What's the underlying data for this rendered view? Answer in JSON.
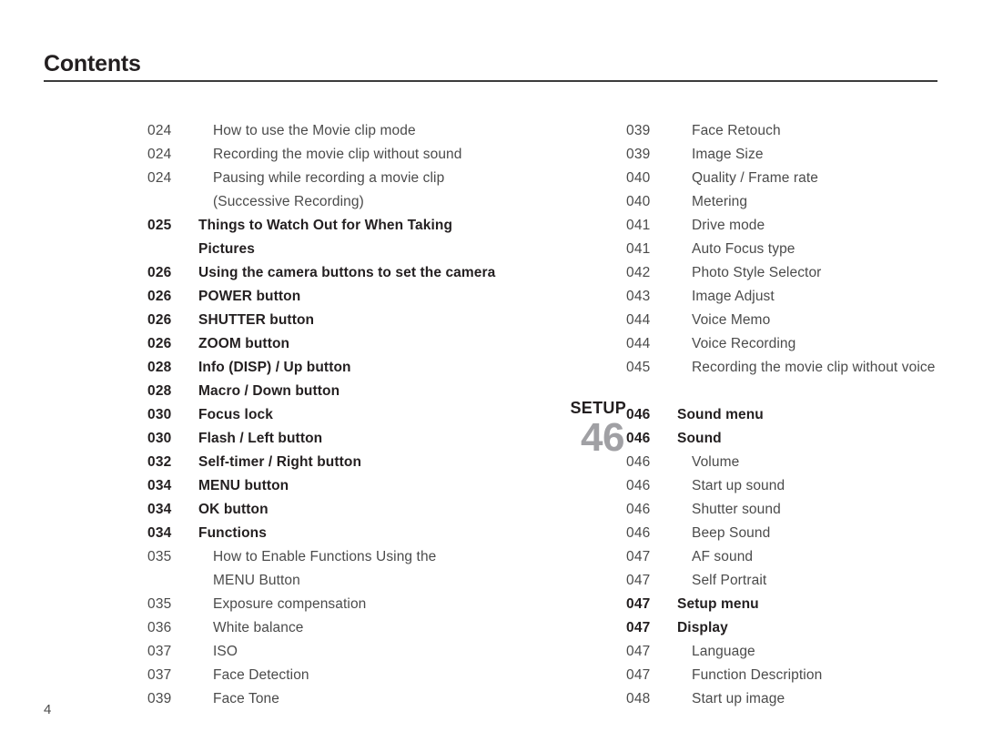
{
  "header": {
    "title": "Contents"
  },
  "footer": {
    "page_number": "4"
  },
  "chapter_marker": {
    "label": "SETUP",
    "number": "46"
  },
  "colors": {
    "text": "#4b4b4b",
    "heading": "#231f20",
    "rule": "#3c3c3c",
    "marker_number": "#a0a0a4"
  },
  "toc": {
    "left_column": [
      {
        "page": "024",
        "label": "How to use the Movie clip mode",
        "bold": false,
        "sub": true
      },
      {
        "page": "024",
        "label": "Recording the movie clip without sound",
        "bold": false,
        "sub": true
      },
      {
        "page": "024",
        "label": "Pausing while recording a movie clip",
        "bold": false,
        "sub": true
      },
      {
        "page": "",
        "label": "(Successive Recording)",
        "bold": false,
        "sub": true
      },
      {
        "page": "025",
        "label": "Things to Watch Out for When Taking",
        "bold": true,
        "sub": false
      },
      {
        "page": "",
        "label": "Pictures",
        "bold": true,
        "sub": false
      },
      {
        "page": "026",
        "label": "Using the camera buttons to set the camera",
        "bold": true,
        "sub": false
      },
      {
        "page": "026",
        "label": "POWER button",
        "bold": true,
        "sub": false
      },
      {
        "page": "026",
        "label": "SHUTTER button",
        "bold": true,
        "sub": false
      },
      {
        "page": "026",
        "label": "ZOOM button",
        "bold": true,
        "sub": false
      },
      {
        "page": "028",
        "label": "Info (DISP) / Up button",
        "bold": true,
        "sub": false
      },
      {
        "page": "028",
        "label": "Macro / Down button",
        "bold": true,
        "sub": false
      },
      {
        "page": "030",
        "label": "Focus lock",
        "bold": true,
        "sub": false
      },
      {
        "page": "030",
        "label": "Flash / Left button",
        "bold": true,
        "sub": false
      },
      {
        "page": "032",
        "label": "Self-timer / Right button",
        "bold": true,
        "sub": false
      },
      {
        "page": "034",
        "label": "MENU button",
        "bold": true,
        "sub": false
      },
      {
        "page": "034",
        "label": "OK button",
        "bold": true,
        "sub": false
      },
      {
        "page": "034",
        "label": "Functions",
        "bold": true,
        "sub": false
      },
      {
        "page": "035",
        "label": "How to Enable Functions Using the",
        "bold": false,
        "sub": true
      },
      {
        "page": "",
        "label": "MENU Button",
        "bold": false,
        "sub": true
      },
      {
        "page": "035",
        "label": "Exposure compensation",
        "bold": false,
        "sub": true
      },
      {
        "page": "036",
        "label": "White balance",
        "bold": false,
        "sub": true
      },
      {
        "page": "037",
        "label": "ISO",
        "bold": false,
        "sub": true
      },
      {
        "page": "037",
        "label": "Face Detection",
        "bold": false,
        "sub": true
      },
      {
        "page": "039",
        "label": "Face Tone",
        "bold": false,
        "sub": true
      }
    ],
    "right_column": [
      {
        "page": "039",
        "label": "Face Retouch",
        "bold": false,
        "sub": true
      },
      {
        "page": "039",
        "label": "Image Size",
        "bold": false,
        "sub": true
      },
      {
        "page": "040",
        "label": "Quality / Frame rate",
        "bold": false,
        "sub": true
      },
      {
        "page": "040",
        "label": "Metering",
        "bold": false,
        "sub": true
      },
      {
        "page": "041",
        "label": "Drive mode",
        "bold": false,
        "sub": true
      },
      {
        "page": "041",
        "label": "Auto Focus type",
        "bold": false,
        "sub": true
      },
      {
        "page": "042",
        "label": "Photo Style Selector",
        "bold": false,
        "sub": true
      },
      {
        "page": "043",
        "label": "Image Adjust",
        "bold": false,
        "sub": true
      },
      {
        "page": "044",
        "label": "Voice Memo",
        "bold": false,
        "sub": true
      },
      {
        "page": "044",
        "label": "Voice Recording",
        "bold": false,
        "sub": true
      },
      {
        "page": "045",
        "label": "Recording the movie clip without voice",
        "bold": false,
        "sub": true
      },
      {
        "page": "",
        "label": "",
        "bold": false,
        "sub": false,
        "spacer": true
      },
      {
        "page": "046",
        "label": "Sound menu",
        "bold": true,
        "sub": false
      },
      {
        "page": "046",
        "label": "Sound",
        "bold": true,
        "sub": false
      },
      {
        "page": "046",
        "label": "Volume",
        "bold": false,
        "sub": true
      },
      {
        "page": "046",
        "label": "Start up sound",
        "bold": false,
        "sub": true
      },
      {
        "page": "046",
        "label": "Shutter sound",
        "bold": false,
        "sub": true
      },
      {
        "page": "046",
        "label": "Beep Sound",
        "bold": false,
        "sub": true
      },
      {
        "page": "047",
        "label": "AF sound",
        "bold": false,
        "sub": true
      },
      {
        "page": "047",
        "label": "Self Portrait",
        "bold": false,
        "sub": true
      },
      {
        "page": "047",
        "label": "Setup menu",
        "bold": true,
        "sub": false
      },
      {
        "page": "047",
        "label": "Display",
        "bold": true,
        "sub": false
      },
      {
        "page": "047",
        "label": "Language",
        "bold": false,
        "sub": true
      },
      {
        "page": "047",
        "label": "Function Description",
        "bold": false,
        "sub": true
      },
      {
        "page": "048",
        "label": "Start up image",
        "bold": false,
        "sub": true
      }
    ]
  }
}
